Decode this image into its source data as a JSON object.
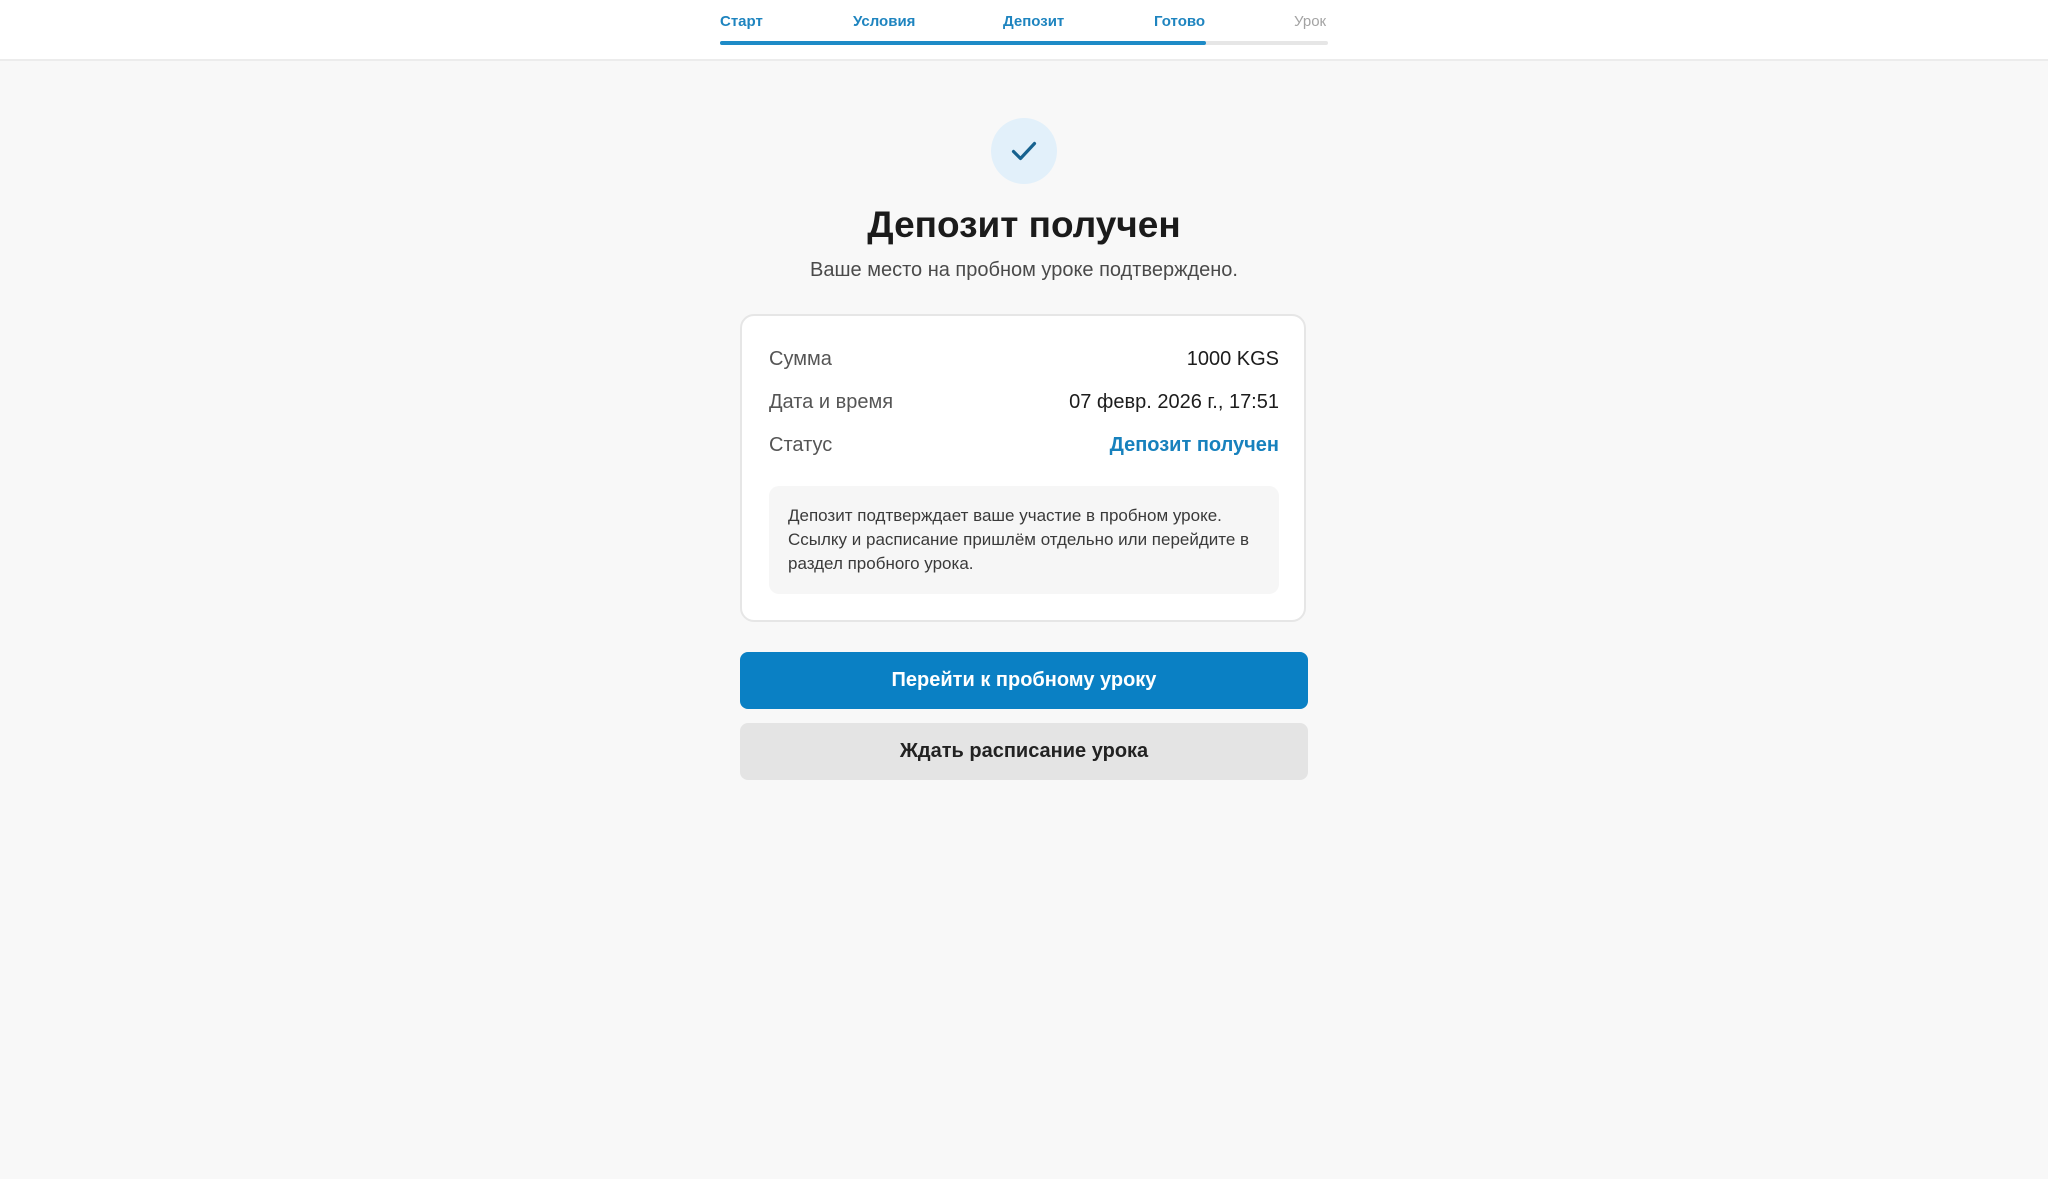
{
  "header": {
    "steps": [
      {
        "label": "Старт",
        "state": "done"
      },
      {
        "label": "Условия",
        "state": "done"
      },
      {
        "label": "Депозит",
        "state": "done"
      },
      {
        "label": "Готово",
        "state": "current"
      },
      {
        "label": "Урок",
        "state": "upcoming"
      }
    ],
    "progress": 0.8
  },
  "hero": {
    "icon": "check-icon",
    "title": "Депозит получен",
    "subtitle": "Ваше место на пробном уроке подтверждено."
  },
  "details": {
    "rows": [
      {
        "label": "Сумма",
        "value": "1000 KGS"
      },
      {
        "label": "Дата и время",
        "value": "07 февр. 2026 г., 17:51"
      },
      {
        "label": "Статус",
        "value": "Депозит получен"
      }
    ],
    "note": "Депозит подтверждает ваше участие в пробном уроке. Ссылку и расписание пришлём отдельно или перейдите в раздел пробного урока."
  },
  "actions": {
    "primary_label": "Перейти к пробному уроку",
    "secondary_label": "Ждать расписание урока"
  },
  "colors": {
    "accent": "#0a80c4",
    "status": "#1781bd",
    "background": "#f8f8f8"
  }
}
